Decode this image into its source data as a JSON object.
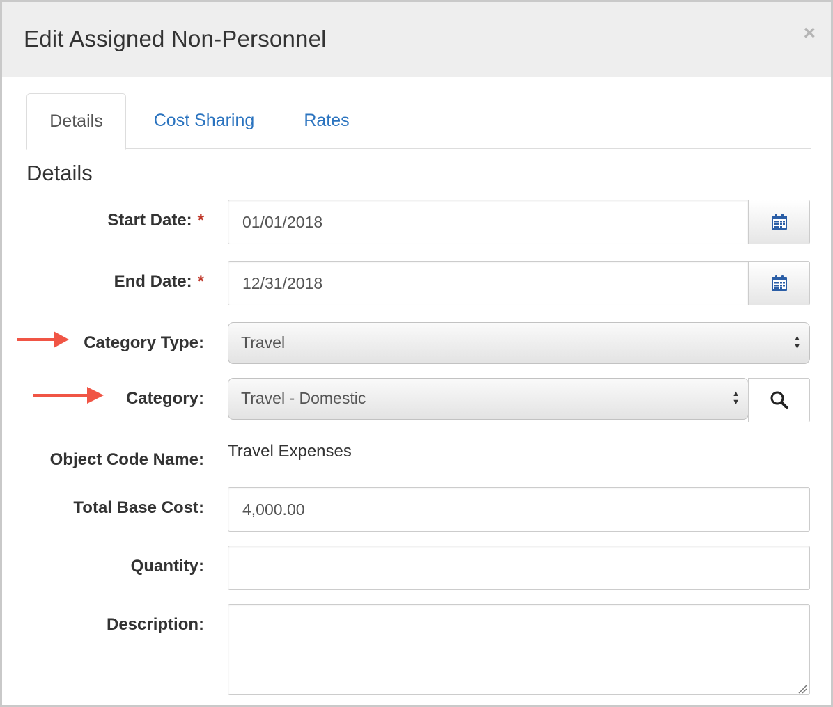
{
  "modal": {
    "title": "Edit Assigned Non-Personnel",
    "close_symbol": "×"
  },
  "tabs": [
    {
      "label": "Details",
      "active": true
    },
    {
      "label": "Cost Sharing",
      "active": false
    },
    {
      "label": "Rates",
      "active": false
    }
  ],
  "section_title": "Details",
  "form": {
    "start_date": {
      "label": "Start Date:",
      "required_mark": "*",
      "value": "01/01/2018",
      "icon": "calendar-icon"
    },
    "end_date": {
      "label": "End Date:",
      "required_mark": "*",
      "value": "12/31/2018",
      "icon": "calendar-icon"
    },
    "category_type": {
      "label": "Category Type:",
      "selected": "Travel"
    },
    "category": {
      "label": "Category:",
      "selected": "Travel - Domestic",
      "icon": "search-icon"
    },
    "object_code_name": {
      "label": "Object Code Name:",
      "value": "Travel Expenses"
    },
    "total_base_cost": {
      "label": "Total Base Cost:",
      "value": "4,000.00"
    },
    "quantity": {
      "label": "Quantity:",
      "value": ""
    },
    "description": {
      "label": "Description:",
      "value": ""
    }
  },
  "colors": {
    "link": "#2a73bf",
    "required": "#c0392b",
    "indicator_arrow": "#f05545",
    "calendar_icon": "#2b5ea6"
  }
}
